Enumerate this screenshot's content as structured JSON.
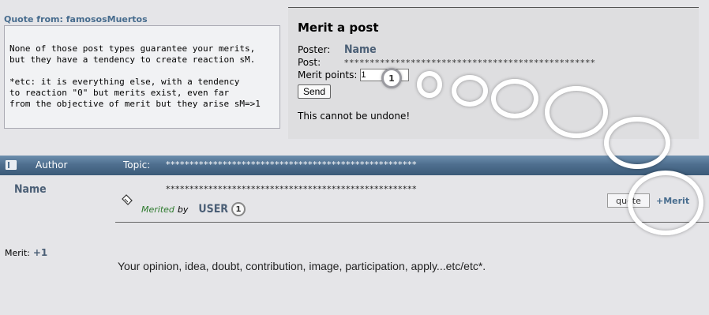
{
  "quote": {
    "header": "Quote from: famososMuertos",
    "body": "None of those post types guarantee your merits,\nbut they have a tendency to create reaction sM.\n\n*etc: it is everything else, with a tendency\nto reaction \"0\" but merits exist, even far\nfrom the objective of merit but they arise sM=>1"
  },
  "merit_form": {
    "title": "Merit a post",
    "poster_label": "Poster:",
    "poster_name": "Name",
    "post_label": "Post:",
    "post_value": "*************************************************",
    "points_label": "Merit points:",
    "points_value": "1",
    "send_label": "Send",
    "warning": "This cannot be undone!"
  },
  "header_bar": {
    "author_label": "Author",
    "topic_label": "Topic:",
    "topic_value": "*****************************************************"
  },
  "post": {
    "author": "Name",
    "title": "*****************************************************",
    "merited_label": "Merited",
    "by_label": "by",
    "merited_user": "USER",
    "merited_count": "1",
    "quote_button": "quote",
    "merit_button": "+Merit",
    "merit_stat_label": "Merit:",
    "merit_stat_value": "+1",
    "body": "Your opinion, idea, doubt, contribution, image, participation, apply...etc/etc*."
  }
}
